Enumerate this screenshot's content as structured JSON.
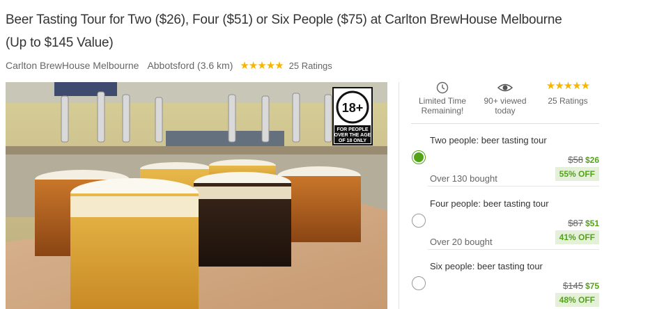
{
  "deal": {
    "title": "Beer Tasting Tour for Two ($26), Four ($51) or Six People ($75) at Carlton BrewHouse Melbourne (Up to $145 Value)",
    "merchant": "Carlton BrewHouse Melbourne",
    "location": "Abbotsford (3.6 km)",
    "rating_stars": 5,
    "ratings_count": "25 Ratings"
  },
  "photo": {
    "badge_number": "18+",
    "badge_text": [
      "FOR PEOPLE",
      "OVER THE AGE",
      "OF 18 ONLY"
    ]
  },
  "stats": [
    {
      "icon": "clock-icon",
      "lines": [
        "Limited Time",
        "Remaining!"
      ]
    },
    {
      "icon": "eye-icon",
      "lines": [
        "90+ viewed",
        "today"
      ]
    },
    {
      "icon": "stars-icon",
      "lines": [
        "25 Ratings"
      ]
    }
  ],
  "options": [
    {
      "title": "Two people: beer tasting tour",
      "old_price": "$58",
      "new_price": "$26",
      "discount": "55% OFF",
      "bought": "Over 130 bought",
      "selected": true
    },
    {
      "title": "Four people: beer tasting tour",
      "old_price": "$87",
      "new_price": "$51",
      "discount": "41% OFF",
      "bought": "Over 20 bought",
      "selected": false
    },
    {
      "title": "Six people: beer tasting tour",
      "old_price": "$145",
      "new_price": "$75",
      "discount": "48% OFF",
      "bought": "",
      "selected": false
    }
  ],
  "colors": {
    "accent_green": "#53a318",
    "discount_bg": "#e4f1d8",
    "star": "#f7b500"
  }
}
